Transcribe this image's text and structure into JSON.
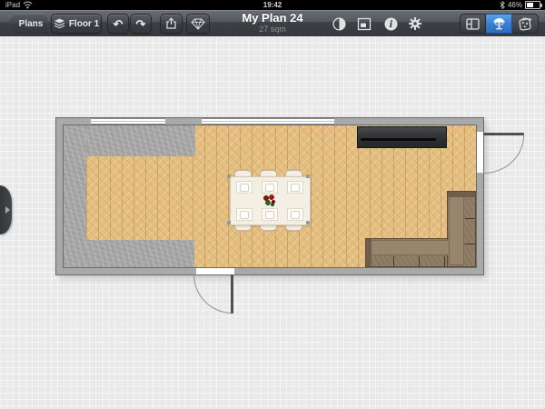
{
  "status_bar": {
    "device": "iPad",
    "time": "19:42",
    "battery_percent": "46%"
  },
  "toolbar": {
    "plans_label": "Plans",
    "floor_label": "Floor 1",
    "title": "My Plan 24",
    "subtitle": "27 sqm",
    "undo_glyph": "↶",
    "redo_glyph": "↷",
    "info_glyph": "i",
    "active_view_color": "#3b7fd2"
  },
  "plan": {
    "area": "27 sqm",
    "objects": [
      "window",
      "window",
      "door",
      "door",
      "tv-cabinet",
      "dining-table",
      "dining-chairs",
      "place-settings",
      "flower-centerpiece",
      "corner-sofa",
      "concrete-floor",
      "parquet-floor"
    ],
    "colors": {
      "parquet": "#e4be80",
      "concrete": "#a6a6a6",
      "wall": "#a9a9a9",
      "sofa": "#89775f",
      "cabinet": "#323437",
      "table": "#f3efe5"
    }
  }
}
